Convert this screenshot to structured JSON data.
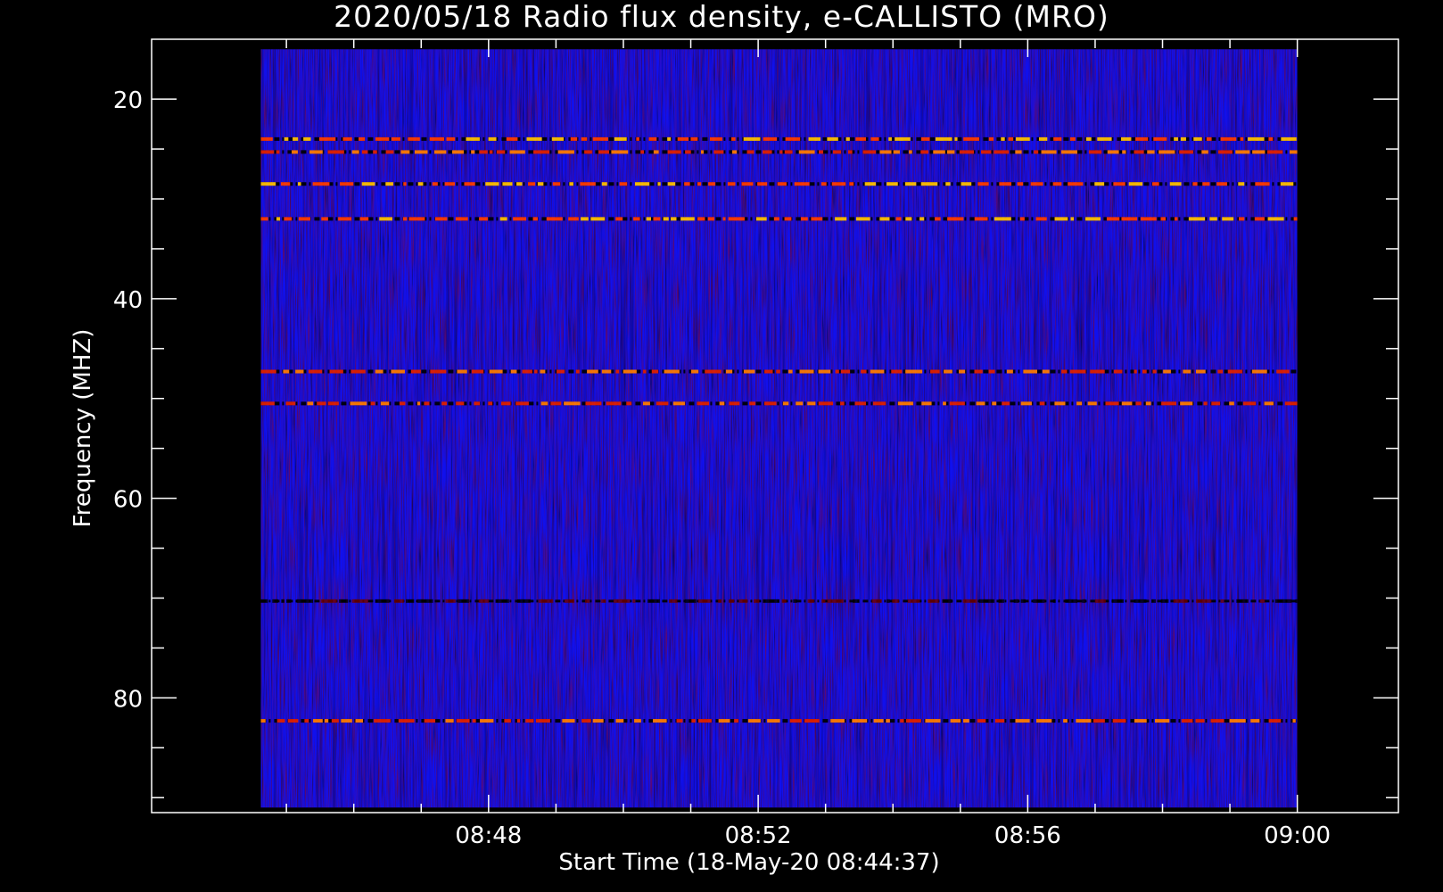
{
  "chart_data": {
    "type": "heatmap",
    "title": "2020/05/18  Radio flux density, e-CALLISTO (MRO)",
    "xlabel": "Start Time (18-May-20 08:44:37)",
    "ylabel": "Frequency (MHZ)",
    "x_range_minutes": [
      "08:44:37",
      "09:00:00"
    ],
    "xlim_minutes_after_0800": [
      44.62,
      60.0
    ],
    "x_axis_extent_minutes_after_0800": [
      43.0,
      61.5
    ],
    "ylim": [
      15,
      91
    ],
    "y_axis_extent": [
      14,
      91.5
    ],
    "y_inverted": true,
    "x_ticks": [
      {
        "value": 48,
        "label": "08:48"
      },
      {
        "value": 52,
        "label": "08:52"
      },
      {
        "value": 56,
        "label": "08:56"
      },
      {
        "value": 60,
        "label": "09:00"
      }
    ],
    "x_minor_ticks": [
      45,
      46,
      47,
      49,
      50,
      51,
      53,
      54,
      55,
      57,
      58,
      59
    ],
    "y_ticks": [
      {
        "value": 20,
        "label": "20"
      },
      {
        "value": 40,
        "label": "40"
      },
      {
        "value": 60,
        "label": "60"
      },
      {
        "value": 80,
        "label": "80"
      }
    ],
    "y_minor_ticks": [
      25,
      30,
      35,
      45,
      50,
      55,
      65,
      70,
      75,
      85,
      90
    ],
    "colormap": [
      "#000000",
      "#0000ff",
      "#b00000",
      "#ff3000",
      "#ffc000"
    ],
    "background_color": "#1010ee",
    "emission_bands_mhz": [
      {
        "freq": 24.0,
        "intensity": "high"
      },
      {
        "freq": 25.3,
        "intensity": "medium"
      },
      {
        "freq": 28.5,
        "intensity": "high"
      },
      {
        "freq": 32.0,
        "intensity": "high"
      },
      {
        "freq": 47.3,
        "intensity": "medium"
      },
      {
        "freq": 50.5,
        "intensity": "medium"
      },
      {
        "freq": 70.3,
        "intensity": "low"
      },
      {
        "freq": 82.3,
        "intensity": "medium"
      }
    ],
    "grid": false
  }
}
